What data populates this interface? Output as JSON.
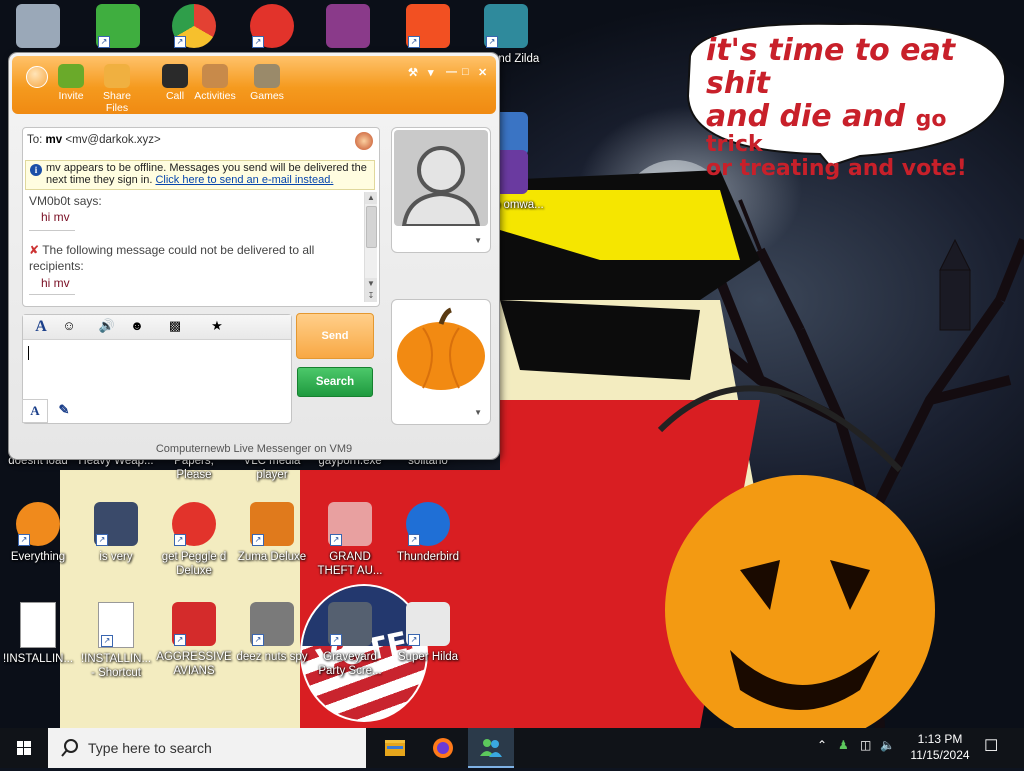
{
  "wallpaper": {
    "bubble": {
      "line1": "it's time to eat shit",
      "line2a": "and die and ",
      "line2b": "go trick",
      "line3": "or treating and vote!"
    },
    "badge_text": "VOTED"
  },
  "desktop_icons": [
    {
      "id": "recycle-bin",
      "label": "",
      "icon": "recycle-bin-icon",
      "color": "#9aa8b8",
      "shortcut": false
    },
    {
      "id": "messenger",
      "label": "",
      "icon": "messenger-icon",
      "color": "#3fae3f",
      "shortcut": true
    },
    {
      "id": "chrome",
      "label": "",
      "icon": "chrome-icon",
      "color": "#e34133",
      "shortcut": true
    },
    {
      "id": "peggle",
      "label": "",
      "icon": "peggle-icon",
      "color": "#e2332b",
      "shortcut": true
    },
    {
      "id": "winrar",
      "label": "",
      "icon": "winrar-icon",
      "color": "#8a3a8a",
      "shortcut": false
    },
    {
      "id": "windows",
      "label": "",
      "icon": "windows-logo-icon",
      "color": "#f25022",
      "shortcut": true
    },
    {
      "id": "legend-zilda",
      "label": "Legend Zilda",
      "icon": "game-character-icon",
      "color": "#2f8a9c",
      "shortcut": true
    },
    {
      "id": "ashma",
      "label": "",
      "icon": "ashma-icon",
      "color": "#3a74c4",
      "shortcut": false
    },
    {
      "id": "daboo",
      "label": "daboo omwa...",
      "icon": "daboo-icon",
      "color": "#6a3aa0",
      "shortcut": false
    },
    {
      "id": "doesnt-load",
      "label": "doesnt load",
      "icon": "",
      "color": "",
      "shortcut": false
    },
    {
      "id": "heavy-weap",
      "label": "Heavy Weap...",
      "icon": "",
      "color": "",
      "shortcut": false
    },
    {
      "id": "papers-please",
      "label": "Papers, Please",
      "icon": "",
      "color": "",
      "shortcut": false
    },
    {
      "id": "vlc",
      "label": "VLC media player",
      "icon": "",
      "color": "",
      "shortcut": false
    },
    {
      "id": "gayporn",
      "label": "gayporn.exe",
      "icon": "",
      "color": "",
      "shortcut": false
    },
    {
      "id": "solitaire",
      "label": "solitario",
      "icon": "",
      "color": "",
      "shortcut": false
    },
    {
      "id": "everything",
      "label": "Everything",
      "icon": "magnifier-icon",
      "color": "#f08a1c",
      "shortcut": true
    },
    {
      "id": "is-very",
      "label": "is very",
      "icon": "shield-logo-icon",
      "color": "#3a4a6a",
      "shortcut": true
    },
    {
      "id": "peggle-deluxe",
      "label": "get Peggle d Deluxe",
      "icon": "peggle-icon",
      "color": "#e2332b",
      "shortcut": true
    },
    {
      "id": "zuma",
      "label": "Zuma Deluxe",
      "icon": "zuma-icon",
      "color": "#e07a1c",
      "shortcut": true
    },
    {
      "id": "gta",
      "label": "GRAND THEFT AU...",
      "icon": "anime-girl-icon",
      "color": "#e8a0a0",
      "shortcut": true
    },
    {
      "id": "thunderbird",
      "label": "Thunderbird",
      "icon": "thunderbird-icon",
      "color": "#1f6fd6",
      "shortcut": true
    },
    {
      "id": "installing",
      "label": "!INSTALLIN...",
      "icon": "document-icon",
      "color": "#ffffff",
      "shortcut": false
    },
    {
      "id": "installing-shortcut",
      "label": "!INSTALLIN... - Shortcut",
      "icon": "document-icon",
      "color": "#ffffff",
      "shortcut": true
    },
    {
      "id": "aggressive-avians",
      "label": "AGGRESSIVE AVIANS",
      "icon": "angry-bird-icon",
      "color": "#d42b2b",
      "shortcut": true
    },
    {
      "id": "deez-nuts",
      "label": "deez nuts spy",
      "icon": "windows-stack-icon",
      "color": "#7a7a7a",
      "shortcut": true
    },
    {
      "id": "graveyard",
      "label": "Graveyard Party Scre...",
      "icon": "graveyard-icon",
      "color": "#556070",
      "shortcut": true
    },
    {
      "id": "super-hilda",
      "label": "Super Hilda",
      "icon": "pixel-character-icon",
      "color": "#e8e8e8",
      "shortcut": true
    }
  ],
  "messenger": {
    "toolbar": [
      {
        "label": "Invite",
        "icon": "invite-icon"
      },
      {
        "label": "Share Files",
        "icon": "share-files-icon"
      },
      {
        "label": "Call",
        "icon": "phone-icon"
      },
      {
        "label": "Activities",
        "icon": "activities-icon"
      },
      {
        "label": "Games",
        "icon": "games-icon"
      }
    ],
    "to_prefix": "To:",
    "to_name": "mv",
    "to_email": "<mv@darkok.xyz>",
    "offline_notice": "mv appears to be offline. Messages you send will be delivered the next time they sign in.",
    "offline_link": "Click here to send an e-mail instead.",
    "sender_says": "VM0b0t says:",
    "message_1": "hi mv",
    "undelivered_notice": "The following message could not be delivered to all recipients:",
    "message_2": "hi mv",
    "send_label": "Send",
    "search_label": "Search",
    "compose_value": "",
    "status_text": "Computernewb Live Messenger on VM9"
  },
  "taskbar": {
    "search_placeholder": "Type here to search",
    "time": "1:13 PM",
    "date": "11/15/2024"
  }
}
